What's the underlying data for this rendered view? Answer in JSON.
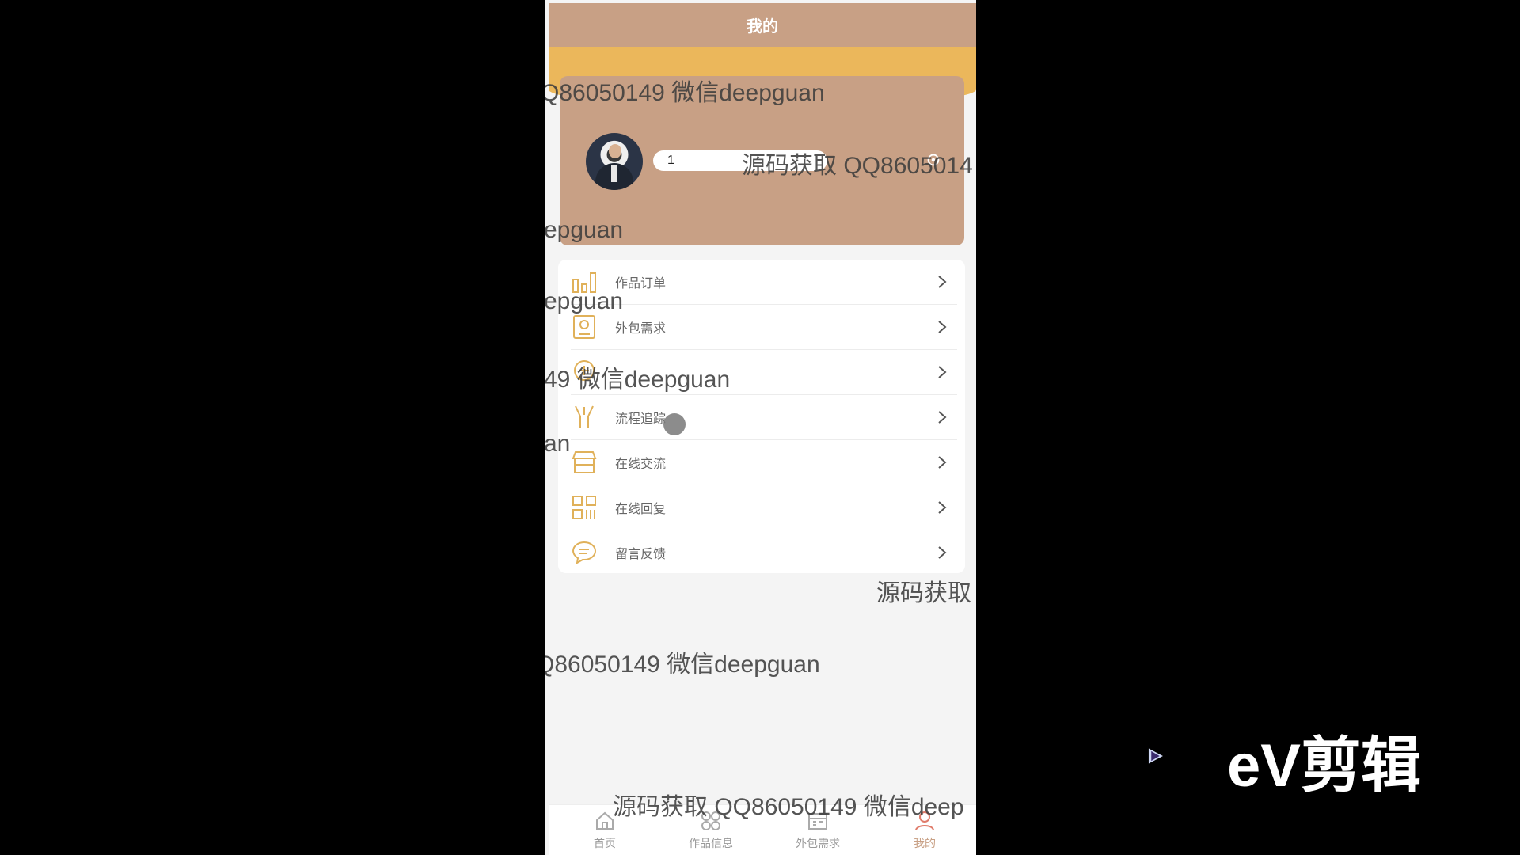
{
  "header": {
    "title": "我的"
  },
  "profile": {
    "username": "1"
  },
  "menu": {
    "items": [
      {
        "label": "作品订单",
        "icon": "bar-chart-icon"
      },
      {
        "label": "外包需求",
        "icon": "document-icon"
      },
      {
        "label": "",
        "icon": "coin-icon"
      },
      {
        "label": "流程追踪",
        "icon": "flow-icon"
      },
      {
        "label": "在线交流",
        "icon": "store-icon"
      },
      {
        "label": "在线回复",
        "icon": "grid-icon"
      },
      {
        "label": "留言反馈",
        "icon": "chat-bubble-icon"
      }
    ]
  },
  "tabbar": {
    "items": [
      {
        "label": "首页"
      },
      {
        "label": "作品信息"
      },
      {
        "label": "外包需求"
      },
      {
        "label": "我的"
      }
    ]
  },
  "watermarks": {
    "w1": "Q86050149 微信deepguan",
    "w2": "源码获取 QQ8605014",
    "w3": "epguan",
    "w4": "epguan",
    "w5": "49 微信deepguan",
    "w6": "an",
    "w7": "源码获取",
    "w8": "Q86050149 微信deepguan",
    "w9": "源码获取 QQ86050149 微信deep"
  },
  "brand": {
    "logo_text": "eV剪辑"
  },
  "colors": {
    "accent": "#c8a085",
    "band": "#ebb75b",
    "icon": "#e0b15a"
  }
}
